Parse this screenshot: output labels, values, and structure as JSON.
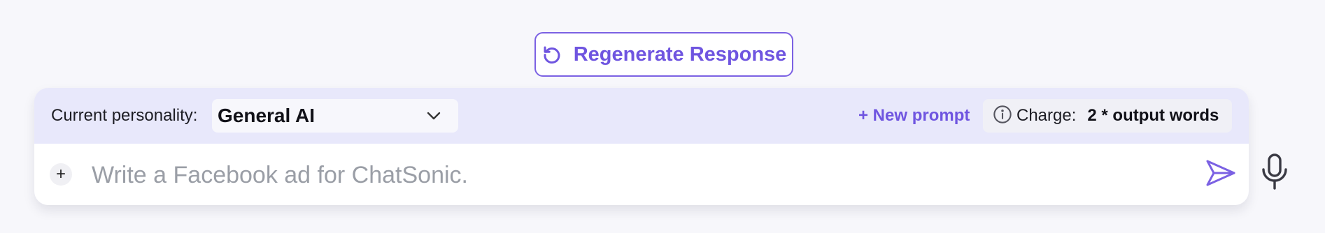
{
  "regenerate": {
    "label": "Regenerate Response",
    "icon": "refresh-icon"
  },
  "toolbar": {
    "personality_label": "Current personality:",
    "personality_value": "General AI",
    "new_prompt_label": "+ New prompt",
    "charge_label": "Charge:",
    "charge_value": "2 * output words"
  },
  "input": {
    "placeholder": "Write a Facebook ad for ChatSonic.",
    "value": ""
  },
  "icons": {
    "attach": "plus-icon",
    "send": "send-icon",
    "mic": "microphone-icon",
    "info": "info-icon",
    "dropdown": "chevron-down-icon"
  },
  "colors": {
    "accent": "#6f55e0",
    "panel": "#e8e8fb",
    "background": "#f7f7fb"
  }
}
